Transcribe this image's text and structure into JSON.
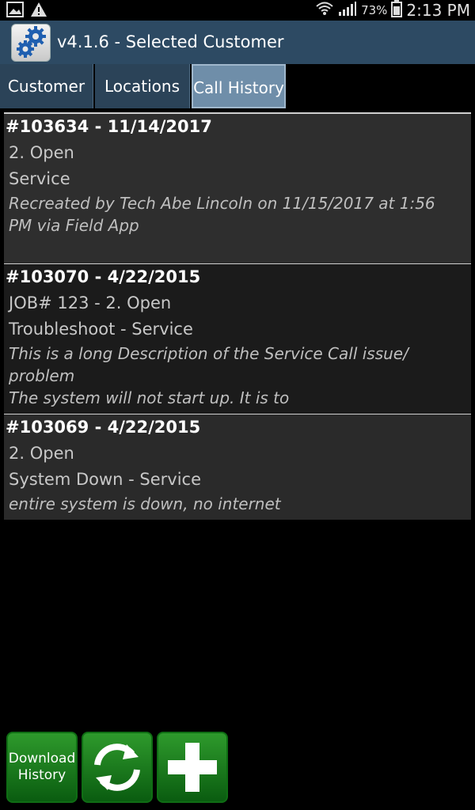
{
  "status_bar": {
    "battery_percent": "73%",
    "time": "2:13 PM",
    "icons": [
      "image-icon",
      "warning-icon",
      "wifi-icon",
      "signal-icon",
      "battery-icon"
    ]
  },
  "action_bar": {
    "title": "v4.1.6 - Selected Customer",
    "app_icon": "gear-icon"
  },
  "tabs": [
    {
      "label": "Customer"
    },
    {
      "label": "Locations"
    },
    {
      "label": "Call History",
      "selected": true
    }
  ],
  "calls": [
    {
      "title": "#103634 - 11/14/2017",
      "status": "2. Open",
      "type": "Service",
      "description": "Recreated by Tech Abe Lincoln on 11/15/2017 at 1:56\nPM via Field App"
    },
    {
      "title": "#103070 - 4/22/2015",
      "status": "JOB# 123 - 2. Open",
      "type": "Troubleshoot - Service",
      "description": "This is a long Description of the Service Call issue/\nproblem\nThe system will not start up.  It is to"
    },
    {
      "title": "#103069 - 4/22/2015",
      "status": "2. Open",
      "type": "System Down - Service",
      "description": "entire system is down, no internet"
    }
  ],
  "buttons": {
    "download_history_label": "Download History",
    "refresh_icon": "refresh-icon",
    "add_icon": "plus-icon"
  },
  "colors": {
    "action_bar": "#2d4a63",
    "tab": "#2b4358",
    "tab_selected": "#6f8ea9",
    "button_green": "#1e8a22"
  }
}
